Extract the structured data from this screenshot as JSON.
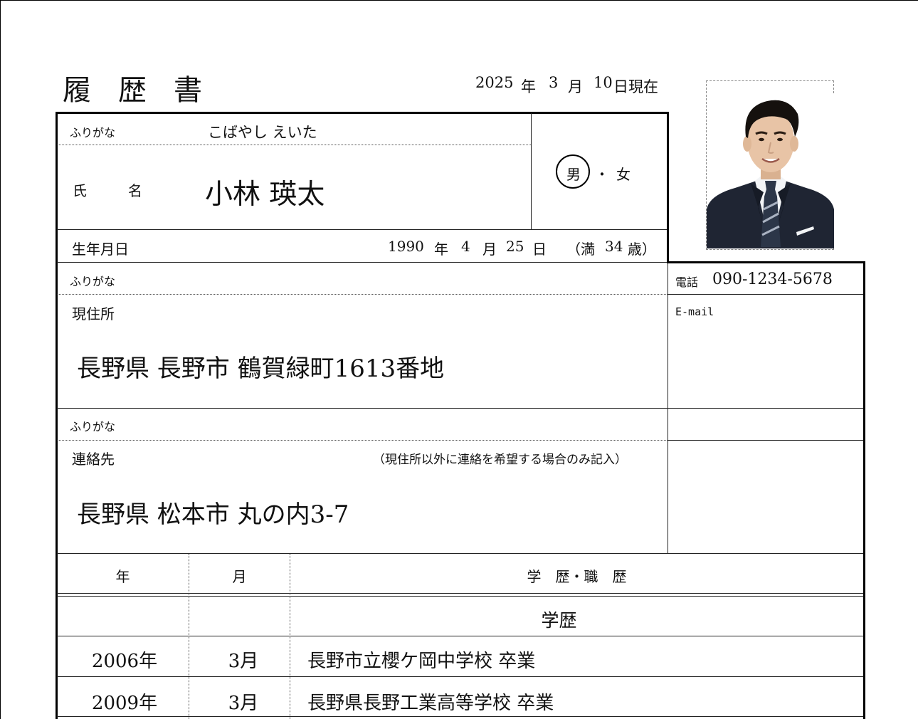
{
  "header": {
    "title_chars": [
      "履",
      "歴",
      "書"
    ],
    "date_year": "2025",
    "date_year_unit": "年",
    "date_month": "3",
    "date_month_unit": "月",
    "date_day": "10",
    "date_suffix": "日現在"
  },
  "name": {
    "furigana_label": "ふりがな",
    "furigana": "こばやし えいた",
    "label_1": "氏",
    "label_2": "名",
    "value": "小林 瑛太"
  },
  "gender": {
    "male": "男",
    "separator": "・",
    "female": "女",
    "selected": "男"
  },
  "birth": {
    "label": "生年月日",
    "year": "1990",
    "year_unit": "年",
    "month": "4",
    "month_unit": "月",
    "day": "25",
    "day_unit": "日",
    "age_open": "（満",
    "age": "34",
    "age_close": "歳）"
  },
  "address": {
    "furigana_label": "ふりがな",
    "label": "現住所",
    "value": "長野県 長野市 鶴賀緑町1613番地"
  },
  "contact_info": {
    "phone_label": "電話",
    "phone": "090-1234-5678",
    "email_label": "E-mail"
  },
  "contact_address": {
    "furigana_label": "ふりがな",
    "label": "連絡先",
    "note": "（現住所以外に連絡を希望する場合のみ記入）",
    "value": "長野県 松本市 丸の内3-7"
  },
  "history": {
    "col_year": "年",
    "col_month": "月",
    "col_detail": "学　歴・職　歴",
    "section_title": "学歴",
    "rows": [
      {
        "year": "2006年",
        "month": "3月",
        "detail": "長野市立櫻ケ岡中学校 卒業"
      },
      {
        "year": "2009年",
        "month": "3月",
        "detail": "長野県長野工業高等学校 卒業"
      }
    ]
  },
  "photo": {
    "subject": "portrait-photo",
    "colors": {
      "suit": "#1f2533",
      "shirt": "#f2f4f6",
      "tie": "#2c3648",
      "skin": "#e8c4a6",
      "hair": "#15110e",
      "background": "#ffffff"
    }
  }
}
